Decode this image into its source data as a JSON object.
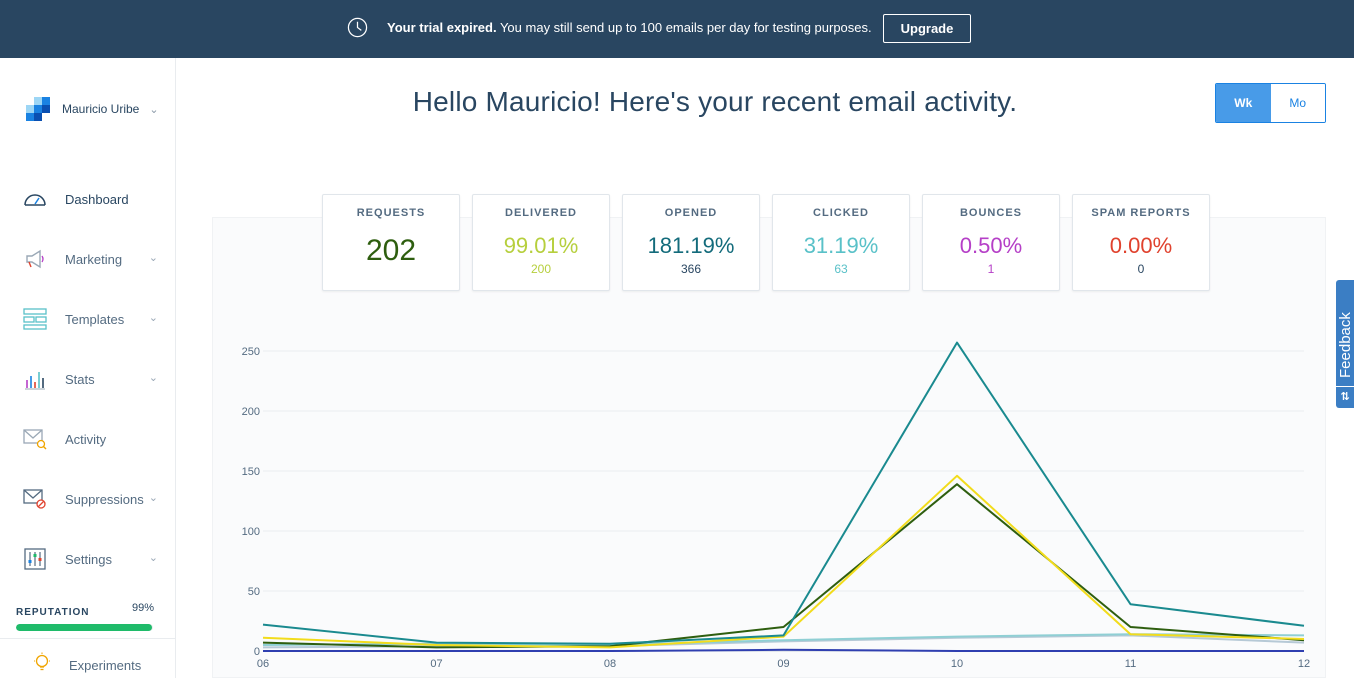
{
  "banner": {
    "icon": "clock-icon",
    "bold_text": "Your trial expired.",
    "text": " You may still send up to 100 emails per day for testing purposes.",
    "upgrade_label": "Upgrade"
  },
  "account": {
    "name": "Mauricio Uribe"
  },
  "sidebar": {
    "items": [
      {
        "label": "Dashboard",
        "icon": "speedometer-icon",
        "has_chevron": false
      },
      {
        "label": "Marketing",
        "icon": "megaphone-icon",
        "has_chevron": true
      },
      {
        "label": "Templates",
        "icon": "templates-icon",
        "has_chevron": true
      },
      {
        "label": "Stats",
        "icon": "bar-chart-icon",
        "has_chevron": true
      },
      {
        "label": "Activity",
        "icon": "envelope-search-icon",
        "has_chevron": false
      },
      {
        "label": "Suppressions",
        "icon": "envelope-blocked-icon",
        "has_chevron": true
      },
      {
        "label": "Settings",
        "icon": "sliders-icon",
        "has_chevron": true
      }
    ],
    "reputation": {
      "title": "REPUTATION",
      "value": "99%",
      "fraction": 0.99
    },
    "experiments": {
      "label": "Experiments",
      "icon": "lightbulb-icon"
    }
  },
  "main": {
    "headline": "Hello Mauricio! Here's your recent email activity.",
    "period_toggle": {
      "week": "Wk",
      "month": "Mo",
      "selected": "Wk"
    }
  },
  "stats": [
    {
      "title": "REQUESTS",
      "value": "202",
      "sub": "",
      "color": "#2e5e0f"
    },
    {
      "title": "DELIVERED",
      "value": "99.01%",
      "sub": "200",
      "color": "#b6cf3d"
    },
    {
      "title": "OPENED",
      "value": "181.19%",
      "sub": "366",
      "color": "#136b7b"
    },
    {
      "title": "CLICKED",
      "value": "31.19%",
      "sub": "63",
      "color": "#59c1c8"
    },
    {
      "title": "BOUNCES",
      "value": "0.50%",
      "sub": "1",
      "color": "#b53fc7"
    },
    {
      "title": "SPAM REPORTS",
      "value": "0.00%",
      "sub": "0",
      "color": "#e0422e"
    }
  ],
  "feedback": {
    "label": "Feedback"
  },
  "chart_data": {
    "type": "line",
    "categories": [
      "06",
      "07",
      "08",
      "09",
      "10",
      "11",
      "12"
    ],
    "ylim": [
      0,
      260
    ],
    "yticks": [
      0,
      50,
      100,
      150,
      200,
      250
    ],
    "grid": true,
    "series": [
      {
        "color": "#1a8a8f",
        "values": [
          22,
          7,
          6,
          13,
          257,
          39,
          21
        ]
      },
      {
        "color": "#f2dc1c",
        "values": [
          11,
          5,
          3,
          12,
          146,
          14,
          10
        ]
      },
      {
        "color": "#2e5e0f",
        "values": [
          7,
          3,
          4,
          20,
          139,
          20,
          9
        ]
      },
      {
        "color": "#8fcfd4",
        "values": [
          5,
          6,
          5,
          9,
          12,
          14,
          13
        ]
      },
      {
        "color": "#b6c9d6",
        "values": [
          3,
          4,
          4,
          8,
          11,
          13,
          7
        ]
      },
      {
        "color": "#2f3fb0",
        "values": [
          0,
          0,
          0,
          1,
          0,
          0,
          0
        ]
      }
    ]
  }
}
